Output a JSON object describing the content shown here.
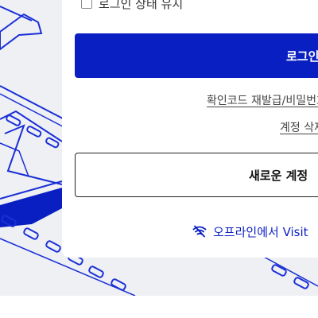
{
  "login_form": {
    "keep_logged_in_label": "로그인 상태 유지",
    "keep_logged_in_checked": false,
    "login_button_label": "로그인"
  },
  "links": {
    "reissue_label": "확인코드 재발급/비밀번호",
    "delete_account_label": "계정 삭제"
  },
  "signup": {
    "new_account_label": "새로운 계정"
  },
  "offline": {
    "label": "오프라인에서 Visit",
    "icon": "wifi-off-icon"
  },
  "colors": {
    "accent": "#0a1fc2",
    "background_art": "#eef0f4",
    "line_art": "#1a2fd6"
  }
}
